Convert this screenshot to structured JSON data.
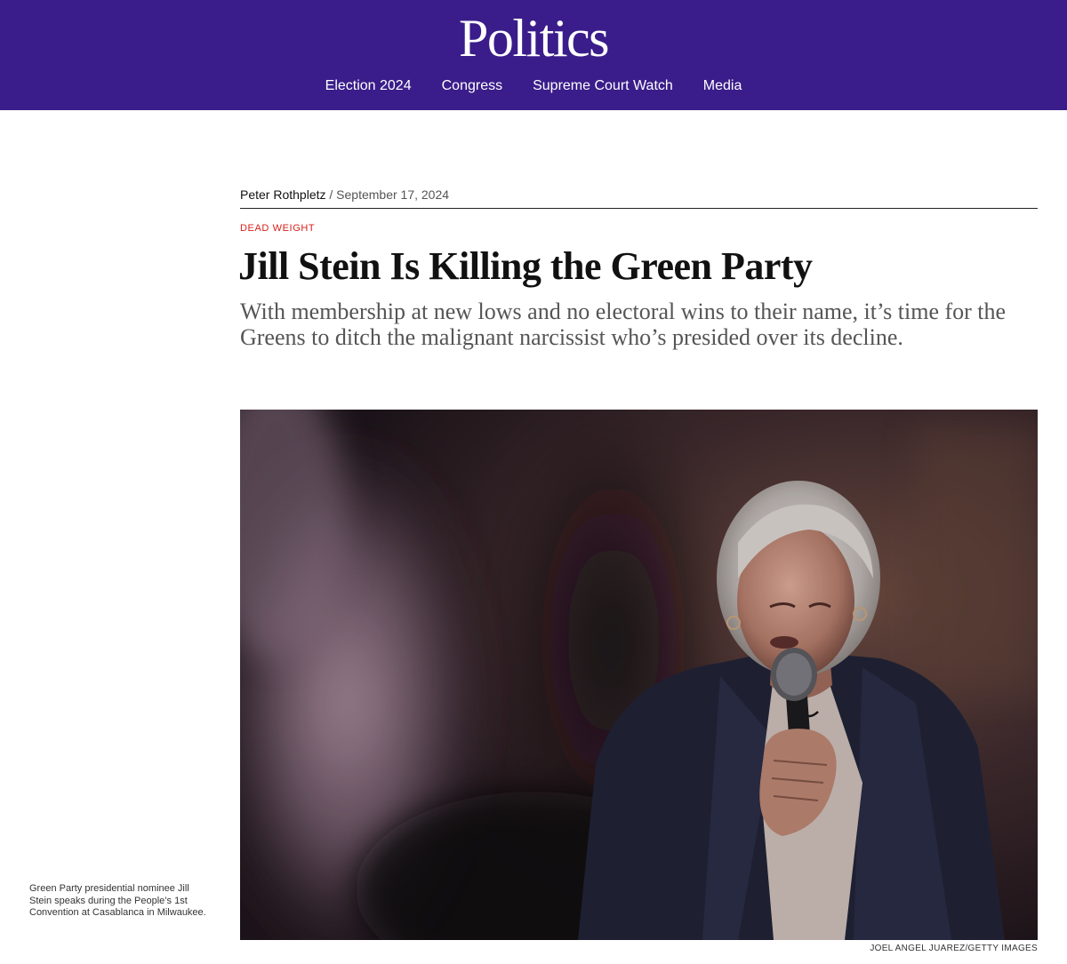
{
  "site": {
    "section_title": "Politics",
    "nav": [
      {
        "label": "Election 2024"
      },
      {
        "label": "Congress"
      },
      {
        "label": "Supreme Court Watch"
      },
      {
        "label": "Media"
      }
    ]
  },
  "article": {
    "author": "Peter Rothpletz",
    "separator": "/",
    "date": "September 17, 2024",
    "kicker": "DEAD WEIGHT",
    "headline": "Jill Stein Is Killing the Green Party",
    "dek": "With membership at new lows and no electoral wins to their name, it’s time for the Greens to ditch the malignant narcissist who’s presided over its decline.",
    "image": {
      "caption": "Green Party presidential nominee Jill Stein speaks during the People’s 1st Convention at Casablanca in Milwaukee.",
      "credit": "JOEL ANGEL JUAREZ/GETTY IMAGES"
    }
  },
  "colors": {
    "masthead_bg": "#3a1d8a",
    "kicker": "#d6201c"
  }
}
